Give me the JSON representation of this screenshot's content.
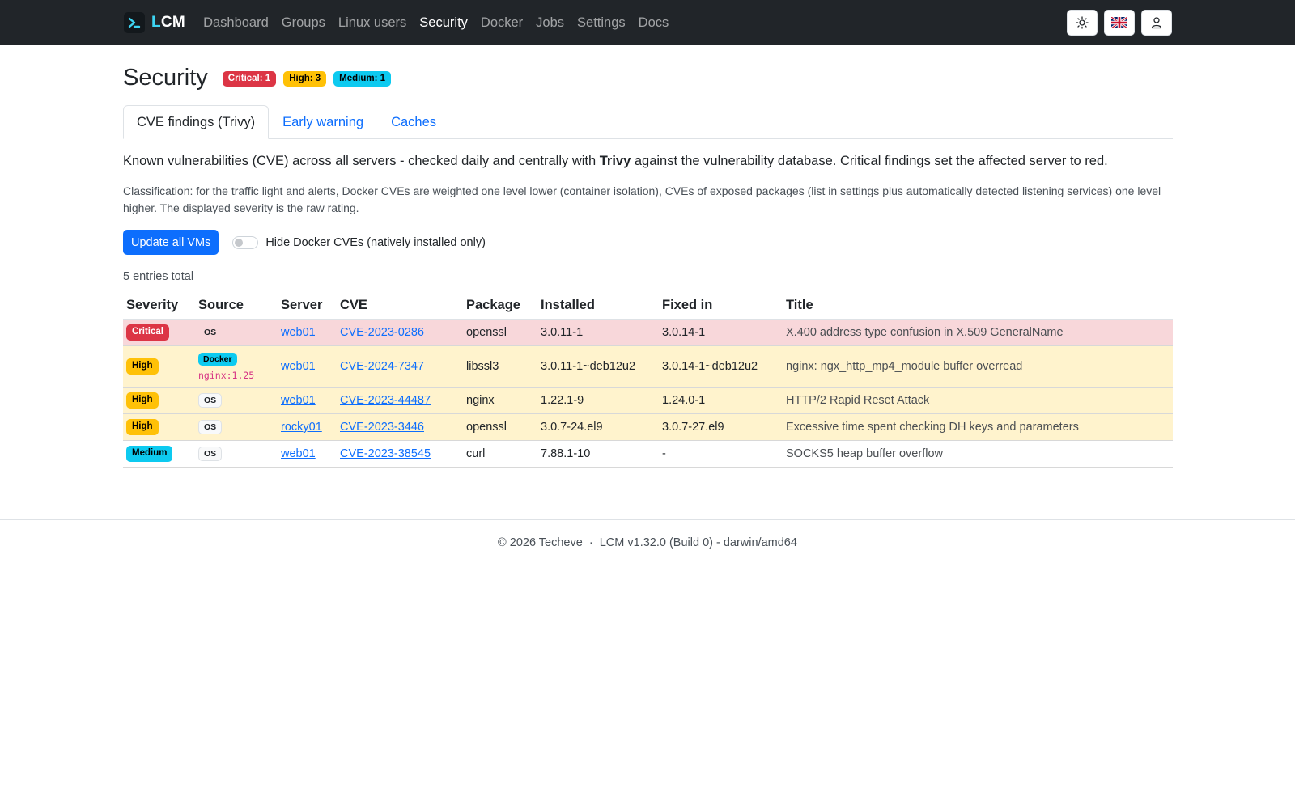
{
  "nav": {
    "brand_prefix": "L",
    "brand_suffix": "CM",
    "links": [
      "Dashboard",
      "Groups",
      "Linux users",
      "Security",
      "Docker",
      "Jobs",
      "Settings",
      "Docs"
    ],
    "active": "Security",
    "icons": [
      "sun-icon",
      "uk-flag-icon",
      "user-icon"
    ]
  },
  "page": {
    "title": "Security",
    "badges": [
      {
        "label": "Critical: 1",
        "level": "danger"
      },
      {
        "label": "High: 3",
        "level": "warning"
      },
      {
        "label": "Medium: 1",
        "level": "info"
      }
    ]
  },
  "tabs": [
    {
      "label": "CVE findings (Trivy)",
      "active": true
    },
    {
      "label": "Early warning",
      "active": false
    },
    {
      "label": "Caches",
      "active": false
    }
  ],
  "intro": {
    "before": "Known vulnerabilities (CVE) across all servers - checked daily and centrally with ",
    "strong": "Trivy",
    "after": " against the vulnerability database. Critical findings set the affected server to red."
  },
  "classification": "Classification: for the traffic light and alerts, Docker CVEs are weighted one level lower (container isolation), CVEs of exposed packages (list in settings plus automatically detected listening services) one level higher. The displayed severity is the raw rating.",
  "controls": {
    "update_button": "Update all VMs",
    "toggle_label": "Hide Docker CVEs (natively installed only)",
    "toggle_on": false
  },
  "total": "5 entries total",
  "table": {
    "headers": [
      "Severity",
      "Source",
      "Server",
      "CVE",
      "Package",
      "Installed",
      "Fixed in",
      "Title"
    ],
    "rows": [
      {
        "severity": "Critical",
        "level": "critical",
        "source": "OS",
        "source_image": "",
        "server": "web01",
        "cve": "CVE-2023-0286",
        "package": "openssl",
        "installed": "3.0.11-1",
        "fixed": "3.0.14-1",
        "title": "X.400 address type confusion in X.509 GeneralName"
      },
      {
        "severity": "High",
        "level": "high",
        "source": "Docker",
        "source_image": "nginx:1.25",
        "server": "web01",
        "cve": "CVE-2024-7347",
        "package": "libssl3",
        "installed": "3.0.11-1~deb12u2",
        "fixed": "3.0.14-1~deb12u2",
        "title": "nginx: ngx_http_mp4_module buffer overread"
      },
      {
        "severity": "High",
        "level": "high",
        "source": "OS",
        "source_image": "",
        "server": "web01",
        "cve": "CVE-2023-44487",
        "package": "nginx",
        "installed": "1.22.1-9",
        "fixed": "1.24.0-1",
        "title": "HTTP/2 Rapid Reset Attack"
      },
      {
        "severity": "High",
        "level": "high",
        "source": "OS",
        "source_image": "",
        "server": "rocky01",
        "cve": "CVE-2023-3446",
        "package": "openssl",
        "installed": "3.0.7-24.el9",
        "fixed": "3.0.7-27.el9",
        "title": "Excessive time spent checking DH keys and parameters"
      },
      {
        "severity": "Medium",
        "level": "medium",
        "source": "OS",
        "source_image": "",
        "server": "web01",
        "cve": "CVE-2023-38545",
        "package": "curl",
        "installed": "7.88.1-10",
        "fixed": "-",
        "title": "SOCKS5 heap buffer overflow"
      }
    ]
  },
  "footer": "© 2026 Techeve  ·  LCM v1.32.0 (Build 0) - darwin/amd64"
}
